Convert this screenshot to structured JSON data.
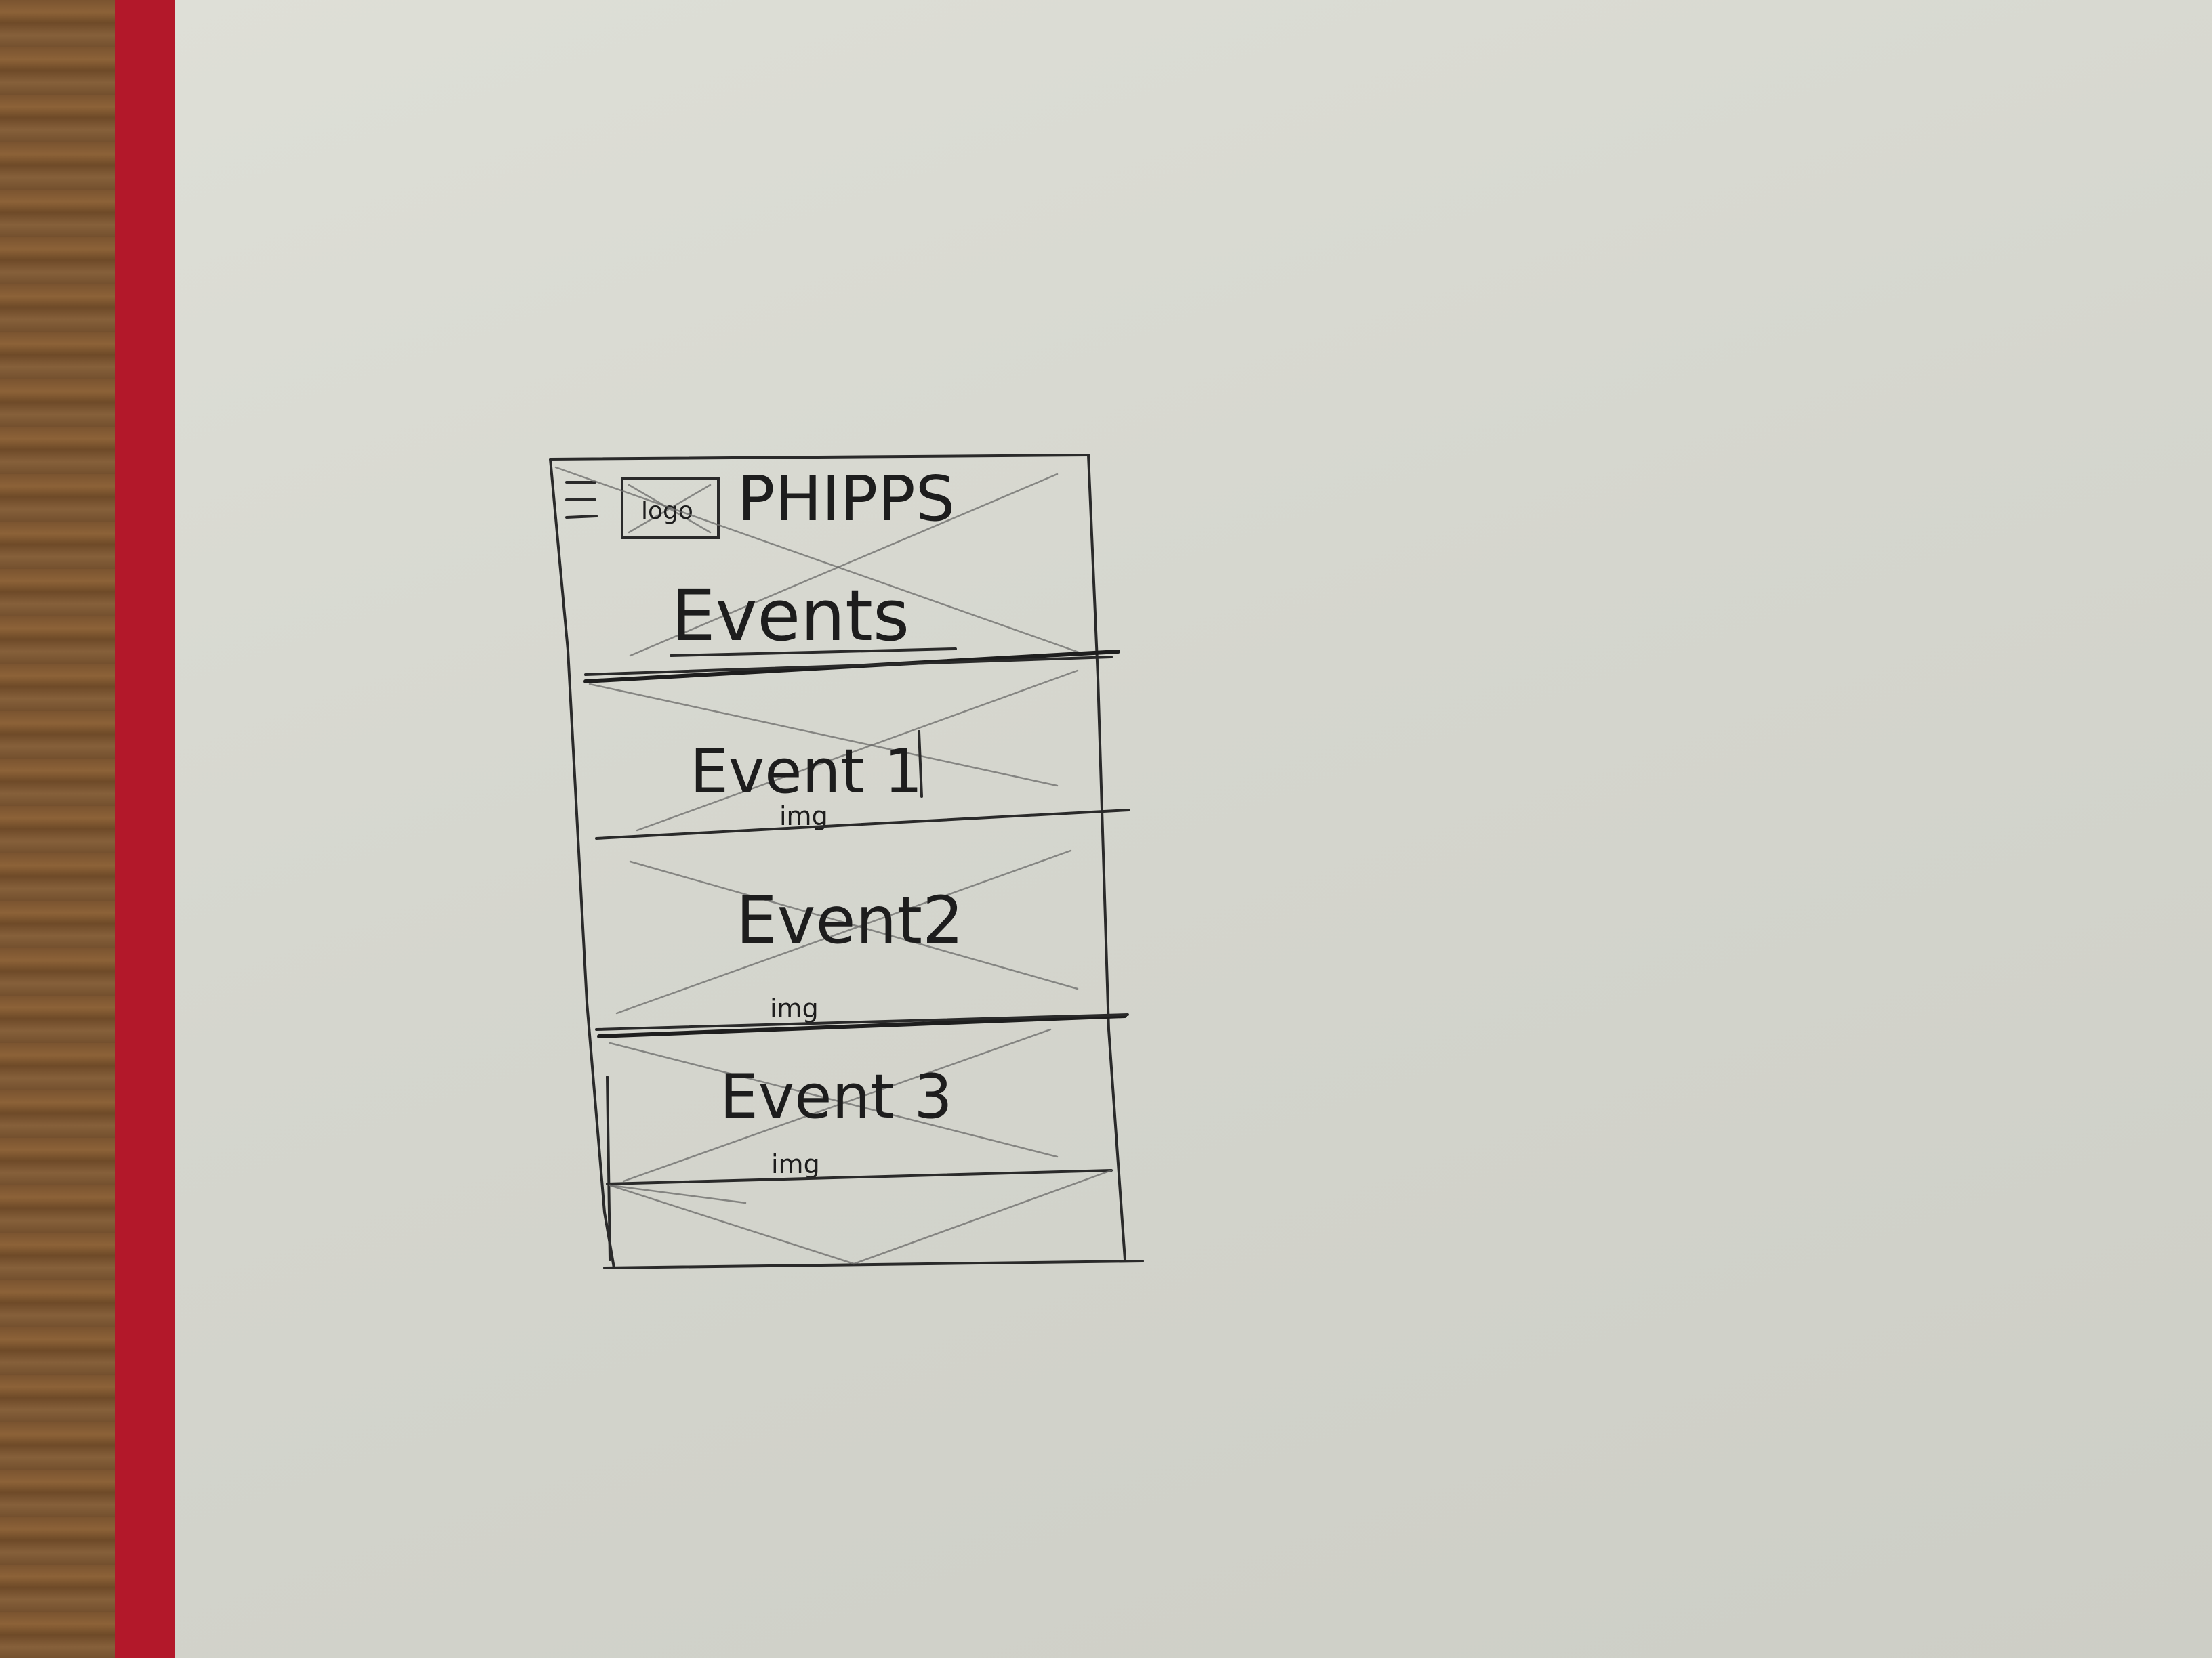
{
  "header": {
    "menu_icon": "hamburger-icon",
    "logo_label": "logo",
    "brand": "PHIPPS"
  },
  "page": {
    "title": "Events"
  },
  "events": [
    {
      "title": "Event 1",
      "image_label": "img"
    },
    {
      "title": "Event2",
      "image_label": "img"
    },
    {
      "title": "Event 3",
      "image_label": "img"
    }
  ],
  "colors": {
    "paper": "#d8d9d1",
    "folder": "#b3182a",
    "pencil": "#2a2a2a"
  }
}
